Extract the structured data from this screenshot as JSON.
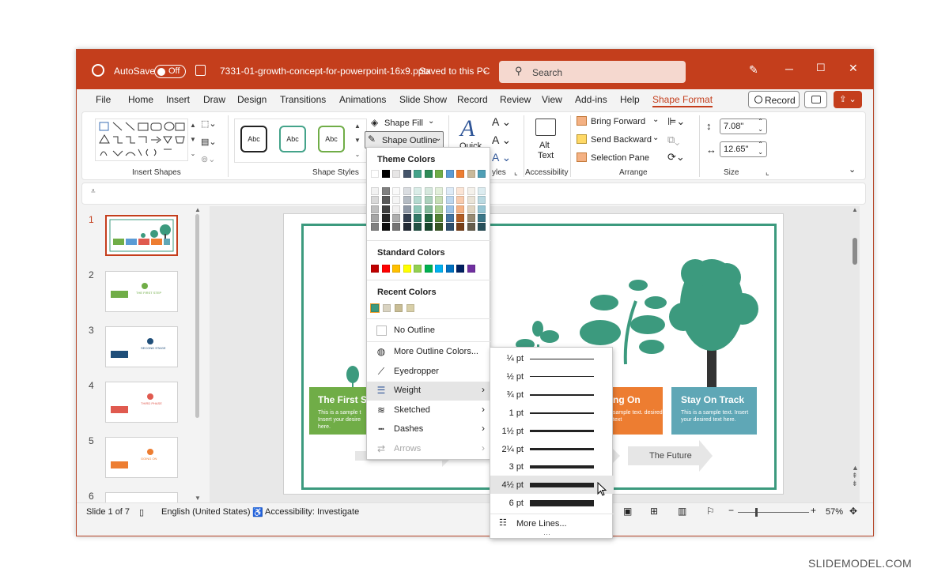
{
  "titlebar": {
    "autosave_label": "AutoSave",
    "autosave_state": "Off",
    "filename": "7331-01-growth-concept-for-powerpoint-16x9.pptx",
    "save_status": "Saved to this PC",
    "search_placeholder": "Search"
  },
  "menubar": {
    "items": [
      "File",
      "Home",
      "Insert",
      "Draw",
      "Design",
      "Transitions",
      "Animations",
      "Slide Show",
      "Record",
      "Review",
      "View",
      "Add-ins",
      "Help",
      "Shape Format"
    ],
    "active": "Shape Format",
    "record_button": "Record"
  },
  "ribbon": {
    "groups": {
      "insert_shapes": "Insert Shapes",
      "shape_styles": "Shape Styles",
      "wordart_styles_partial": "yles",
      "accessibility": "Accessibility",
      "arrange": "Arrange",
      "size": "Size"
    },
    "style_swatch_label": "Abc",
    "shape_fill": "Shape Fill",
    "shape_outline": "Shape Outline",
    "quick_styles": "Quick",
    "alt_text_line1": "Alt",
    "alt_text_line2": "Text",
    "bring_forward": "Bring Forward",
    "send_backward": "Send Backward",
    "selection_pane": "Selection Pane",
    "height_value": "7.08\"",
    "width_value": "12.65\""
  },
  "thumbnails": {
    "numbers": [
      "1",
      "2",
      "3",
      "4",
      "5",
      "6"
    ],
    "selected": "1",
    "t2": "THE FIRST STEP",
    "t3": "SECOND STAGE",
    "t4": "THIRD PHASE",
    "t5": "GOING ON"
  },
  "slide": {
    "box1_title": "The First S",
    "box1_text": "This is a sample t Insert your desire here.",
    "box3_title": "ng On",
    "box3_text": "sample text. desired text",
    "box4_title": "Stay On Track",
    "box4_text": "This is a sample text. Insert your desired text here.",
    "arrow_label": "The Future"
  },
  "statusbar": {
    "slide_info": "Slide 1 of 7",
    "language": "English (United States)",
    "accessibility": "Accessibility: Investigate",
    "zoom": "57%"
  },
  "outline_menu": {
    "theme_colors": "Theme Colors",
    "standard_colors": "Standard Colors",
    "recent_colors": "Recent Colors",
    "no_outline": "No Outline",
    "more_colors": "More Outline Colors...",
    "eyedropper": "Eyedropper",
    "weight": "Weight",
    "sketched": "Sketched",
    "dashes": "Dashes",
    "arrows": "Arrows",
    "theme_top": [
      "#ffffff",
      "#000000",
      "#e7e6e6",
      "#44546a",
      "#44a38a",
      "#2e8b57",
      "#70ad47",
      "#5b9bd5",
      "#ed7d31",
      "#c9b99a",
      "#4f9fb5"
    ],
    "standard": [
      "#c00000",
      "#ff0000",
      "#ffc000",
      "#ffff00",
      "#92d050",
      "#00b050",
      "#00b0f0",
      "#0070c0",
      "#002060",
      "#7030a0"
    ],
    "recent": [
      "#3c9a7e",
      "#d9d3c1",
      "#c9bd95",
      "#d8cfa8"
    ]
  },
  "weight_menu": {
    "weights": [
      "¼ pt",
      "½ pt",
      "¾ pt",
      "1 pt",
      "1½ pt",
      "2¼ pt",
      "3 pt",
      "4½ pt",
      "6 pt"
    ],
    "highlighted": "4½ pt",
    "more_lines": "More Lines..."
  },
  "watermark": "SLIDEMODEL.COM"
}
